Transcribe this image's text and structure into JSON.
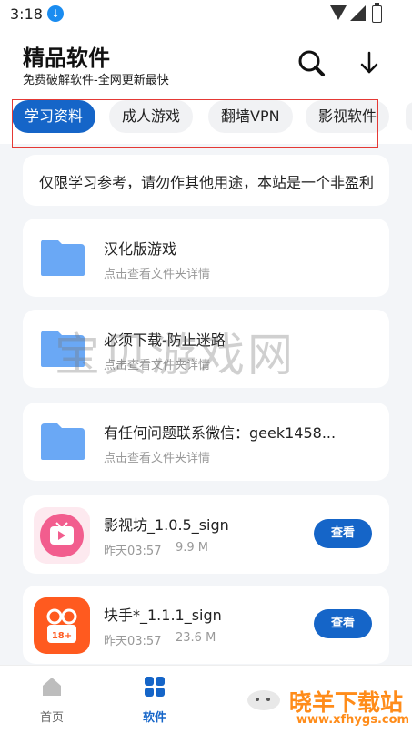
{
  "status": {
    "time": "3:18"
  },
  "header": {
    "title": "精品软件",
    "subtitle": "免费破解软件-全网更新最快"
  },
  "tabs": [
    {
      "label": "学习资料",
      "active": true
    },
    {
      "label": "成人游戏",
      "active": false
    },
    {
      "label": "翻墙VPN",
      "active": false
    },
    {
      "label": "影视软件",
      "active": false
    }
  ],
  "notice": "仅限学习参考，请勿作其他用途，本站是一个非盈利",
  "folders": [
    {
      "title": "汉化版游戏",
      "subtitle": "点击查看文件夹详情"
    },
    {
      "title": "必须下载-防止迷路",
      "subtitle": "点击查看文件夹详情"
    },
    {
      "title": "有任何问题联系微信：geek1458...",
      "subtitle": "点击查看文件夹详情"
    }
  ],
  "apps": [
    {
      "title": "影视坊_1.0.5_sign",
      "date": "昨天03:57",
      "size": "9.9 M",
      "button": "查看"
    },
    {
      "title": "块手*_1.1.1_sign",
      "date": "昨天03:57",
      "size": "23.6 M",
      "button": "查看"
    }
  ],
  "watermark": {
    "main": "宝贝游戏网",
    "brand": "晓羊下载站",
    "url": "www.xfhygs.com"
  },
  "nav": [
    {
      "label": "首页",
      "active": false
    },
    {
      "label": "软件",
      "active": true
    }
  ],
  "colors": {
    "accent": "#1565c8",
    "folder": "#6aa8f5",
    "highlight": "#e53935"
  }
}
